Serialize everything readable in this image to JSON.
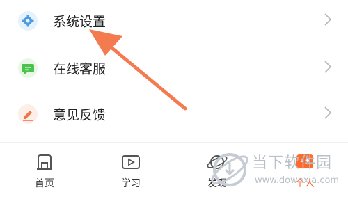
{
  "menu": {
    "items": [
      {
        "label": "系统设置",
        "icon": "gear-icon",
        "icon_bg": "#e6f2fb",
        "icon_color": "#4a9be0"
      },
      {
        "label": "在线客服",
        "icon": "chat-icon",
        "icon_bg": "#e8f7e6",
        "icon_color": "#4bc24b"
      },
      {
        "label": "意见反馈",
        "icon": "pencil-icon",
        "icon_bg": "#fdeee7",
        "icon_color": "#f2734a"
      }
    ]
  },
  "tabbar": {
    "tabs": [
      {
        "label": "首页",
        "icon": "home-icon"
      },
      {
        "label": "学习",
        "icon": "play-icon"
      },
      {
        "label": "发现",
        "icon": "planet-icon"
      },
      {
        "label": "个人",
        "icon": "person-icon",
        "active": true
      }
    ]
  },
  "annotation": {
    "arrow_color": "#f47a4f"
  },
  "watermark": {
    "title": "当下软件园",
    "url": "www.downxia.com"
  }
}
